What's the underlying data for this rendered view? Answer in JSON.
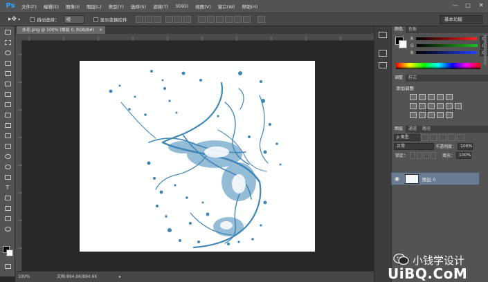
{
  "app": {
    "logo": "Ps"
  },
  "menu": [
    "文件(F)",
    "编辑(E)",
    "图像(I)",
    "图层(L)",
    "类型(Y)",
    "选择(S)",
    "滤镜(T)",
    "3D(D)",
    "视图(V)",
    "窗口(W)",
    "帮助(H)"
  ],
  "window_controls": {
    "minimize": "—",
    "maximize": "□",
    "close": "✕"
  },
  "options": {
    "auto_select_label": "自动选择：",
    "auto_select_value": "组",
    "show_transform_label": "显示变换控件",
    "workspace": "基本功能"
  },
  "document": {
    "tab_title": "水花.png @ 100% (图层 0, RGB/8#)",
    "tab_close": "×",
    "zoom": "100%",
    "doc_info": "文档:894.6K/894.6K"
  },
  "color_panel": {
    "tabs": [
      "颜色",
      "色板"
    ],
    "channels": [
      {
        "label": "R",
        "value": "0",
        "color": "#ff2020"
      },
      {
        "label": "G",
        "value": "0",
        "color": "#20c020"
      },
      {
        "label": "B",
        "value": "0",
        "color": "#2040ff"
      }
    ]
  },
  "adjust_panel": {
    "tabs": [
      "调整",
      "样式"
    ],
    "title": "添加调整"
  },
  "layers_panel": {
    "tabs": [
      "图层",
      "通道",
      "路径"
    ],
    "filter": "ρ 类型",
    "blend_mode": "正常",
    "opacity_label": "不透明度：",
    "opacity_value": "100%",
    "lock_label": "锁定：",
    "fill_label": "填充：",
    "fill_value": "100%",
    "layers": [
      {
        "name": "图层 0",
        "visible": true
      }
    ]
  },
  "watermark": {
    "line1": "小钱学设计",
    "line2": "UiBQ.CoM"
  },
  "colors": {
    "accent": "#31a8ff",
    "water": "#3f86b8",
    "selected_layer": "#6a7a90"
  }
}
